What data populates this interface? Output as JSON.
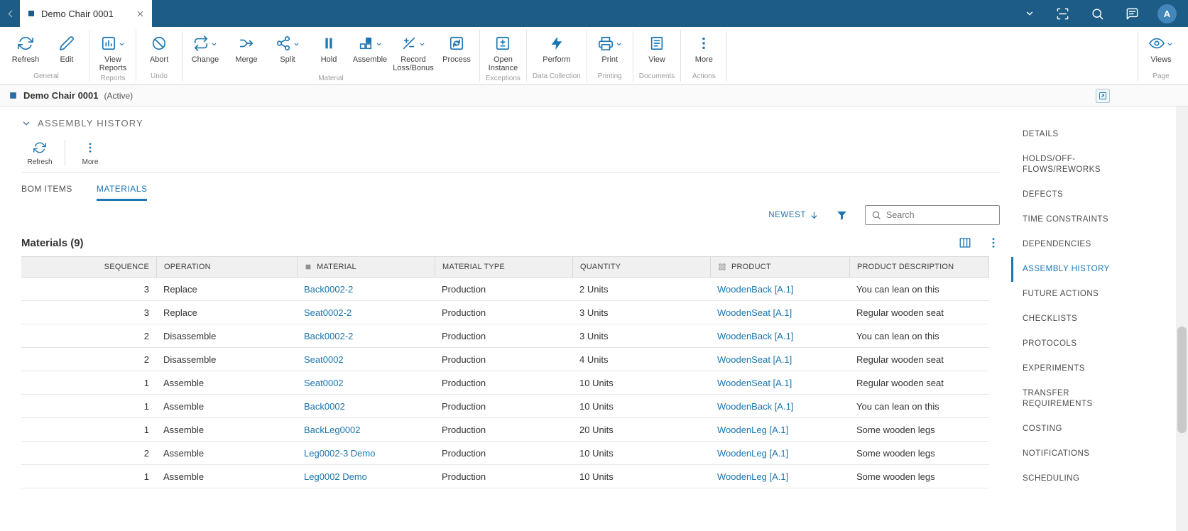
{
  "colors": {
    "topbar_blue": "#1d5c87",
    "accent_blue": "#1b76b2",
    "link_blue": "#1a75ad",
    "header_gray": "#f0f0f0"
  },
  "topbar": {
    "tab_title": "Demo Chair 0001",
    "avatar_initial": "A"
  },
  "toolbar": {
    "groups": [
      {
        "label": "General",
        "buttons": [
          {
            "label": "Refresh",
            "icon": "refresh-icon"
          },
          {
            "label": "Edit",
            "icon": "edit-icon"
          }
        ]
      },
      {
        "label": "Reports",
        "buttons": [
          {
            "label": "View Reports",
            "icon": "bar-chart-icon",
            "dropdown": true
          }
        ]
      },
      {
        "label": "Undo",
        "buttons": [
          {
            "label": "Abort",
            "icon": "abort-icon"
          }
        ]
      },
      {
        "label": "Material",
        "buttons": [
          {
            "label": "Change",
            "icon": "change-icon",
            "dropdown": true
          },
          {
            "label": "Merge",
            "icon": "merge-icon"
          },
          {
            "label": "Split",
            "icon": "split-icon",
            "dropdown": true
          },
          {
            "label": "Hold",
            "icon": "hold-icon"
          },
          {
            "label": "Assemble",
            "icon": "assemble-icon",
            "dropdown": true
          },
          {
            "label": "Record Loss/Bonus",
            "icon": "plus-minus-icon",
            "dropdown": true
          },
          {
            "label": "Process",
            "icon": "process-icon"
          }
        ]
      },
      {
        "label": "Exceptions",
        "buttons": [
          {
            "label": "Open Instance",
            "icon": "open-instance-icon"
          }
        ]
      },
      {
        "label": "Data Collection",
        "buttons": [
          {
            "label": "Perform",
            "icon": "lightning-icon"
          }
        ]
      },
      {
        "label": "Printing",
        "buttons": [
          {
            "label": "Print",
            "icon": "print-icon",
            "dropdown": true
          }
        ]
      },
      {
        "label": "Documents",
        "buttons": [
          {
            "label": "View",
            "icon": "document-icon"
          }
        ]
      },
      {
        "label": "Actions",
        "buttons": [
          {
            "label": "More",
            "icon": "more-dots-icon"
          }
        ]
      },
      {
        "label": "Page",
        "buttons": [
          {
            "label": "Views",
            "icon": "eye-icon",
            "dropdown": true
          }
        ]
      }
    ]
  },
  "titlebar": {
    "title": "Demo Chair 0001",
    "status": "(Active)"
  },
  "section": {
    "title": "ASSEMBLY HISTORY"
  },
  "panel_toolbar": {
    "refresh_label": "Refresh",
    "more_label": "More"
  },
  "tabs": [
    {
      "label": "BOM ITEMS",
      "active": false
    },
    {
      "label": "MATERIALS",
      "active": true
    }
  ],
  "filters": {
    "sort_label": "NEWEST",
    "search_placeholder": "Search"
  },
  "table": {
    "title": "Materials (9)",
    "columns": [
      "SEQUENCE",
      "OPERATION",
      "MATERIAL",
      "MATERIAL TYPE",
      "QUANTITY",
      "PRODUCT",
      "PRODUCT DESCRIPTION"
    ],
    "rows": [
      {
        "sequence": "3",
        "operation": "Replace",
        "material": "Back0002-2",
        "material_type": "Production",
        "quantity": "2 Units",
        "product": "WoodenBack [A.1]",
        "product_description": "You can lean on this"
      },
      {
        "sequence": "3",
        "operation": "Replace",
        "material": "Seat0002-2",
        "material_type": "Production",
        "quantity": "3 Units",
        "product": "WoodenSeat [A.1]",
        "product_description": "Regular wooden seat"
      },
      {
        "sequence": "2",
        "operation": "Disassemble",
        "material": "Back0002-2",
        "material_type": "Production",
        "quantity": "3 Units",
        "product": "WoodenBack [A.1]",
        "product_description": "You can lean on this"
      },
      {
        "sequence": "2",
        "operation": "Disassemble",
        "material": "Seat0002",
        "material_type": "Production",
        "quantity": "4 Units",
        "product": "WoodenSeat [A.1]",
        "product_description": "Regular wooden seat"
      },
      {
        "sequence": "1",
        "operation": "Assemble",
        "material": "Seat0002",
        "material_type": "Production",
        "quantity": "10 Units",
        "product": "WoodenSeat [A.1]",
        "product_description": "Regular wooden seat"
      },
      {
        "sequence": "1",
        "operation": "Assemble",
        "material": "Back0002",
        "material_type": "Production",
        "quantity": "10 Units",
        "product": "WoodenBack [A.1]",
        "product_description": "You can lean on this"
      },
      {
        "sequence": "1",
        "operation": "Assemble",
        "material": "BackLeg0002",
        "material_type": "Production",
        "quantity": "20 Units",
        "product": "WoodenLeg [A.1]",
        "product_description": "Some wooden legs"
      },
      {
        "sequence": "2",
        "operation": "Assemble",
        "material": "Leg0002-3 Demo",
        "material_type": "Production",
        "quantity": "10 Units",
        "product": "WoodenLeg [A.1]",
        "product_description": "Some wooden legs"
      },
      {
        "sequence": "1",
        "operation": "Assemble",
        "material": "Leg0002 Demo",
        "material_type": "Production",
        "quantity": "10 Units",
        "product": "WoodenLeg [A.1]",
        "product_description": "Some wooden legs"
      }
    ]
  },
  "sidebar": {
    "items": [
      {
        "label": "DETAILS"
      },
      {
        "label": "HOLDS/OFF-FLOWS/REWORKS"
      },
      {
        "label": "DEFECTS"
      },
      {
        "label": "TIME CONSTRAINTS"
      },
      {
        "label": "DEPENDENCIES"
      },
      {
        "label": "ASSEMBLY HISTORY",
        "active": true
      },
      {
        "label": "FUTURE ACTIONS"
      },
      {
        "label": "CHECKLISTS"
      },
      {
        "label": "PROTOCOLS"
      },
      {
        "label": "EXPERIMENTS"
      },
      {
        "label": "TRANSFER REQUIREMENTS"
      },
      {
        "label": "COSTING"
      },
      {
        "label": "NOTIFICATIONS"
      },
      {
        "label": "SCHEDULING"
      }
    ]
  }
}
